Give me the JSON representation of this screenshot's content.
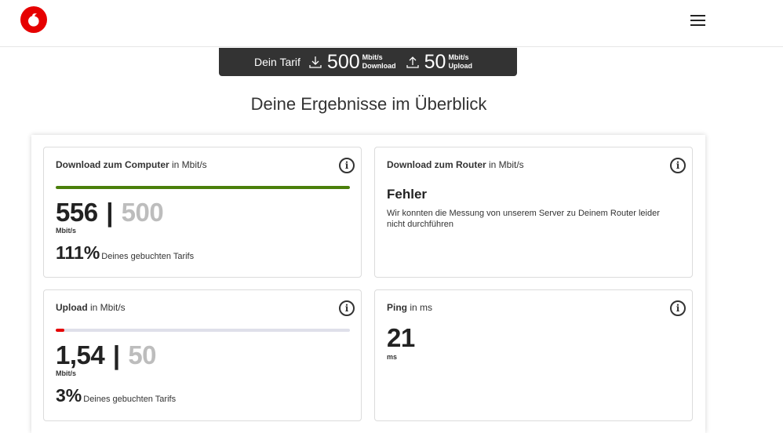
{
  "header": {
    "logo_icon": "vodafone-logo-icon",
    "menu_icon": "hamburger-menu-icon",
    "brand_color": "#e60000"
  },
  "tariff": {
    "label": "Dein Tarif",
    "download_icon": "download-arrow-icon",
    "download_value": "500",
    "download_unit": "Mbit/s",
    "download_word": "Download",
    "upload_icon": "upload-arrow-icon",
    "upload_value": "50",
    "upload_unit": "Mbit/s",
    "upload_word": "Upload"
  },
  "title": "Deine Ergebnisse im Überblick",
  "cards": {
    "download_computer": {
      "title_bold": "Download zum Computer",
      "title_rest": " in Mbit/s",
      "value": "556",
      "separator": "|",
      "target": "500",
      "unit": "Mbit/s",
      "percent": "111%",
      "percent_label": "Deines gebuchten Tarifs",
      "fill_fraction": 1.0,
      "bar_color": "#4a7f0a",
      "info_icon": "info-icon"
    },
    "download_router": {
      "title_bold": "Download zum Router",
      "title_rest": " in Mbit/s",
      "error_title": "Fehler",
      "error_text": "Wir konnten die Messung von unserem Server zu Deinem Router leider nicht durchführen",
      "info_icon": "info-icon"
    },
    "upload": {
      "title_bold": "Upload",
      "title_rest": " in Mbit/s",
      "value": "1,54",
      "separator": "|",
      "target": "50",
      "unit": "Mbit/s",
      "percent": "3%",
      "percent_label": "Deines gebuchten Tarifs",
      "fill_fraction": 0.03,
      "bar_color": "#e60000",
      "track_color": "#dfe0ea",
      "info_icon": "info-icon"
    },
    "ping": {
      "title_bold": "Ping",
      "title_rest": " in ms",
      "value": "21",
      "unit": "ms",
      "info_icon": "info-icon"
    }
  }
}
